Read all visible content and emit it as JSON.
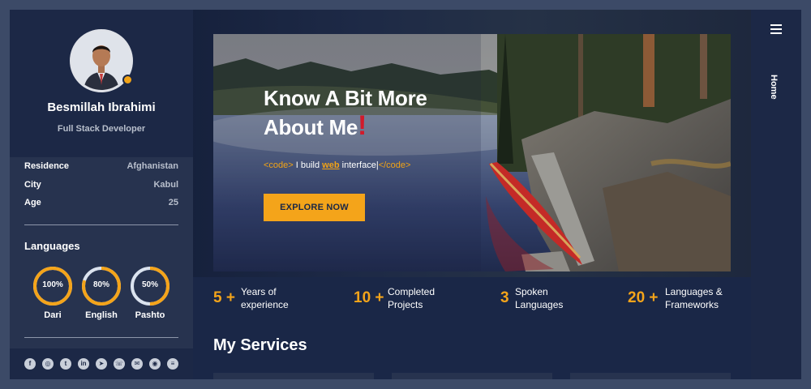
{
  "profile": {
    "name": "Besmillah Ibrahimi",
    "role": "Full Stack Developer"
  },
  "info": [
    {
      "key": "Residence",
      "value": "Afghanistan"
    },
    {
      "key": "City",
      "value": "Kabul"
    },
    {
      "key": "Age",
      "value": "25"
    }
  ],
  "languages": {
    "title": "Languages",
    "items": [
      {
        "label": "Dari",
        "value": "100%",
        "percent": 100
      },
      {
        "label": "English",
        "value": "80%",
        "percent": 80
      },
      {
        "label": "Pashto",
        "value": "50%",
        "percent": 50
      }
    ]
  },
  "social_icons": [
    "facebook-icon",
    "instagram-icon",
    "twitter-icon",
    "linkedin-icon",
    "telegram-icon",
    "whatsapp-icon",
    "email-icon",
    "github-icon",
    "stackoverflow-icon"
  ],
  "hero": {
    "title_line1": "Know A Bit More",
    "title_line2": "About Me",
    "title_mark": "!",
    "code_open": "<code>",
    "code_text_before": " I build ",
    "code_highlight": "web",
    "code_text_after": " interface|",
    "code_close": "</code>",
    "button_label": "EXPLORE NOW"
  },
  "stats": [
    {
      "number": "5 +",
      "line1": "Years of",
      "line2": "experience"
    },
    {
      "number": "10 +",
      "line1": "Completed",
      "line2": "Projects"
    },
    {
      "number": "3",
      "line1": "Spoken",
      "line2": "Languages"
    },
    {
      "number": "20 +",
      "line1": "Languages &",
      "line2": "Frameworks"
    }
  ],
  "services": {
    "title": "My Services"
  },
  "rail": {
    "menu_icon": "hamburger-icon",
    "nav_label": "Home"
  },
  "colors": {
    "accent": "#f4a41a",
    "page_bg": "#1a2747",
    "sidebar_bg": "#27334f",
    "exclaim": "#d21a2a"
  }
}
